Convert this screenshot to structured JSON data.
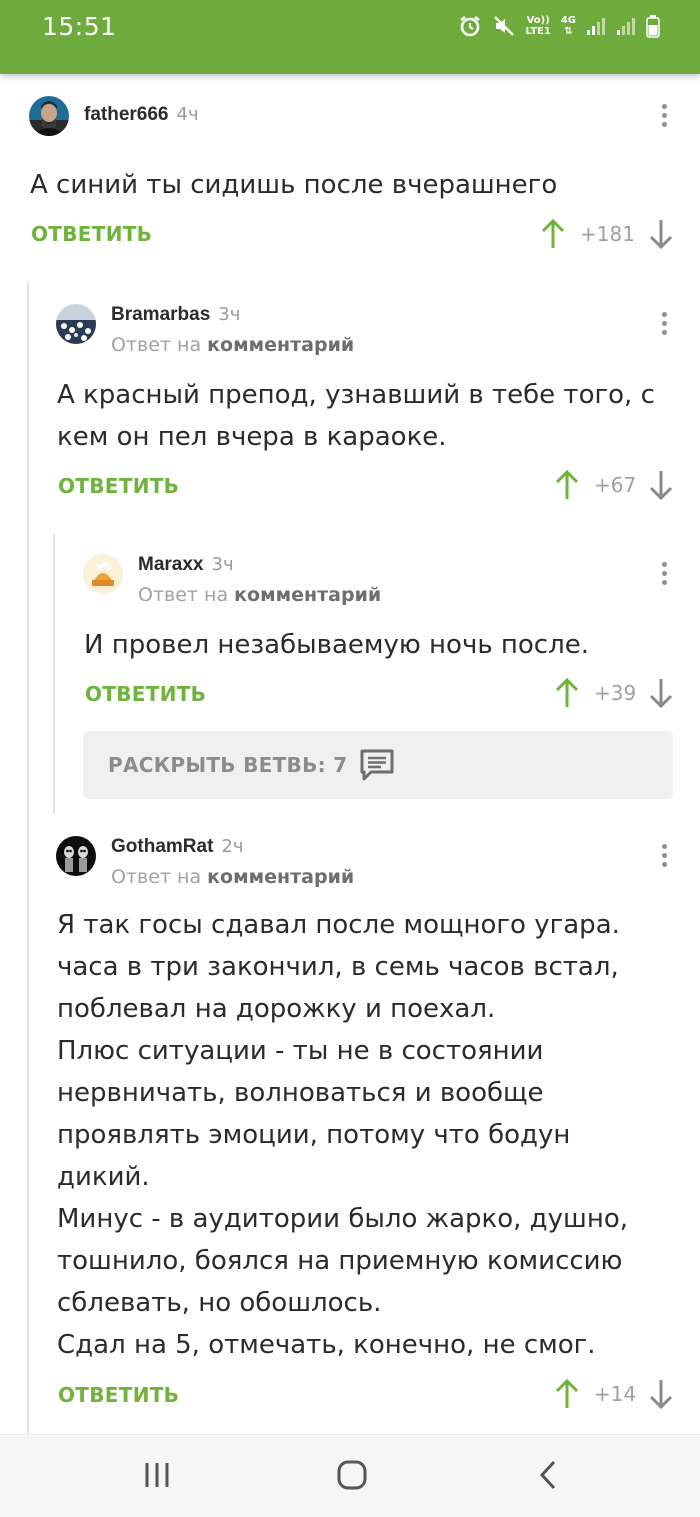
{
  "status_bar": {
    "time": "15:51",
    "network_label_top": "Vo))",
    "network_label_bottom": "LTE1",
    "network_type": "4G",
    "icons": [
      "alarm-icon",
      "mute-icon",
      "volte-icon",
      "signal-icon",
      "signal-icon-2",
      "battery-icon"
    ],
    "accent_color": "#6faa3c"
  },
  "comments": [
    {
      "username": "father666",
      "time_ago": "4ч",
      "reply_prefix": "",
      "reply_target": "",
      "text": "А синий ты сидишь после вчерашнего",
      "reply_label": "ОТВЕТИТЬ",
      "rating": "+181"
    },
    {
      "username": "Bramarbas",
      "time_ago": "3ч",
      "reply_prefix": "Ответ на",
      "reply_target": "комментарий",
      "text": "А красный препод, узнавший в тебе того, с\nкем он пел вчера в караоке.",
      "reply_label": "ОТВЕТИТЬ",
      "rating": "+67"
    },
    {
      "username": "Maraxx",
      "time_ago": "3ч",
      "reply_prefix": "Ответ на",
      "reply_target": "комментарий",
      "text": "И провел незабываемую ночь после.",
      "reply_label": "ОТВЕТИТЬ",
      "rating": "+39"
    },
    {
      "username": "GothamRat",
      "time_ago": "2ч",
      "reply_prefix": "Ответ на",
      "reply_target": "комментарий",
      "text": "Я так госы сдавал после мощного угара.\nчаса в три закончил, в семь часов встал,\nпоблевал на дорожку и поехал.\nПлюс ситуации - ты не в состоянии\nнервничать, волноваться и вообще\nпроявлять эмоции, потому что бодун\nдикий.\nМинус - в аудитории было жарко, душно,\nтошнило, боялся на приемную комиссию\nсблевать, но обошлось.\nСдал на 5, отмечать, конечно, не смог.",
      "reply_label": "ОТВЕТИТЬ",
      "rating": "+14"
    }
  ],
  "expand_branch": {
    "label": "РАСКРЫТЬ ВЕТВЬ: 7"
  },
  "colors": {
    "green": "#6fb33c",
    "upvote": "#6fb33c",
    "downvote": "#8a8a8a",
    "text": "#2b2b2b",
    "muted": "#9a9a9a"
  }
}
